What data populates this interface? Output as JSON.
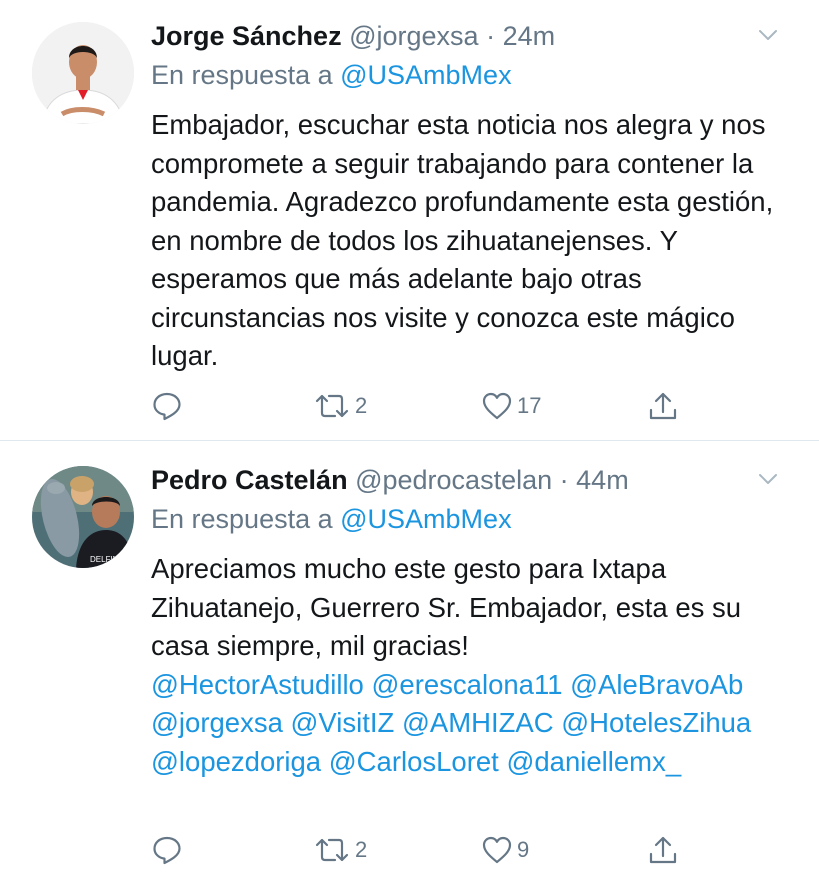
{
  "tweets": [
    {
      "name": "Jorge Sánchez",
      "handle": "@jorgexsa",
      "separator": "·",
      "time": "24m",
      "reply_prefix": "En respuesta a ",
      "reply_to": "@USAmbMex",
      "text": "Embajador, escuchar esta noticia nos alegra y nos compromete a seguir trabajando para contener la pandemia. Agradezco profundamente esta gestión, en nombre de todos los zihuatanejenses. Y esperamos que más adelante bajo otras circunstancias nos visite y conozca este mágico lugar.",
      "retweets": "2",
      "likes": "17"
    },
    {
      "name": "Pedro Castelán",
      "handle": "@pedrocastelan",
      "separator": "·",
      "time": "44m",
      "reply_prefix": "En respuesta a ",
      "reply_to": "@USAmbMex",
      "text": "Apreciamos mucho este gesto para Ixtapa Zihuatanejo, Guerrero Sr. Embajador, esta es su casa siempre, mil gracias!",
      "mentions": "@HectorAstudillo @erescalona11 @AleBravoAb @jorgexsa @VisitIZ @AMHIZAC @HotelesZihua @lopezdoriga @CarlosLoret @daniellemx_",
      "retweets": "2",
      "likes": "9"
    }
  ],
  "icons": {
    "reply": "reply-icon",
    "retweet": "retweet-icon",
    "like": "heart-icon",
    "share": "share-icon",
    "menu": "chevron-down-icon"
  },
  "colors": {
    "link": "#1b95e0",
    "muted": "#657786",
    "text": "#14171a",
    "divider": "#e1e8ed"
  }
}
